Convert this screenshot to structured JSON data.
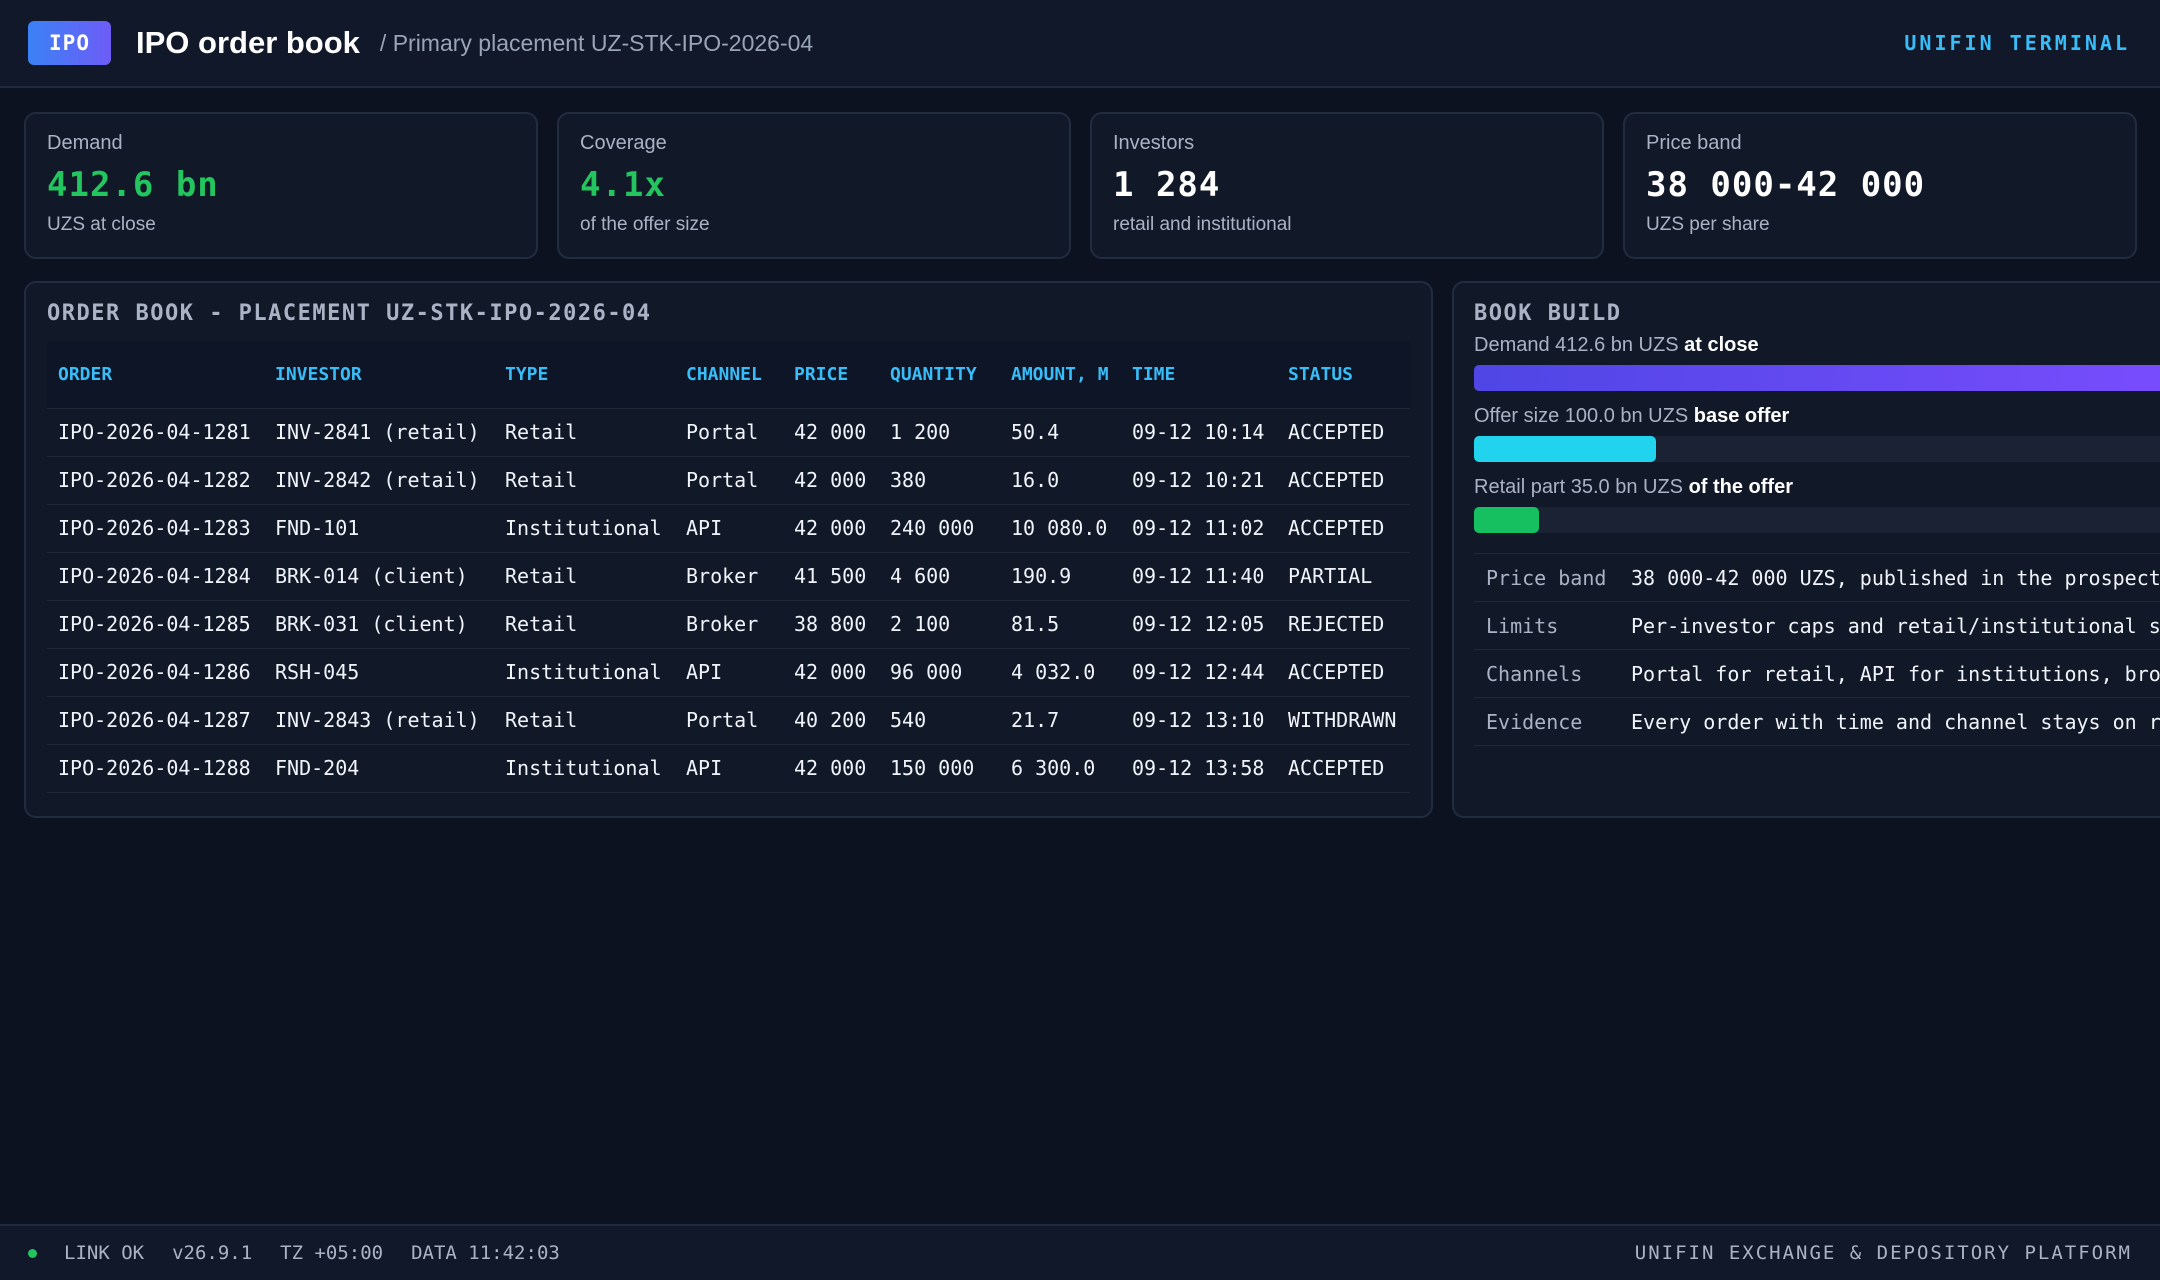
{
  "header": {
    "badge": "IPO",
    "title": "IPO order book",
    "subtitle": "/ Primary placement UZ-STK-IPO-2026-04",
    "brand": "UNIFIN TERMINAL"
  },
  "kpis": [
    {
      "label": "Demand",
      "value": "412.6 bn",
      "note": "UZS at close"
    },
    {
      "label": "Coverage",
      "value": "4.1x",
      "note": "of the offer size"
    },
    {
      "label": "Investors",
      "value": "1 284",
      "note": "retail and institutional"
    },
    {
      "label": "Price band",
      "value": "38 000-42 000",
      "note": "UZS per share"
    }
  ],
  "order_book": {
    "title": "ORDER BOOK - PLACEMENT UZ-STK-IPO-2026-04",
    "columns": [
      "ORDER",
      "INVESTOR",
      "TYPE",
      "CHANNEL",
      "PRICE",
      "QUANTITY",
      "AMOUNT, M",
      "TIME",
      "STATUS"
    ],
    "rows": [
      [
        "IPO-2026-04-1281",
        "INV-2841 (retail)",
        "Retail",
        "Portal",
        "42 000",
        "1 200",
        "50.4",
        "09-12 10:14",
        "ACCEPTED"
      ],
      [
        "IPO-2026-04-1282",
        "INV-2842 (retail)",
        "Retail",
        "Portal",
        "42 000",
        "380",
        "16.0",
        "09-12 10:21",
        "ACCEPTED"
      ],
      [
        "IPO-2026-04-1283",
        "FND-101",
        "Institutional",
        "API",
        "42 000",
        "240 000",
        "10 080.0",
        "09-12 11:02",
        "ACCEPTED"
      ],
      [
        "IPO-2026-04-1284",
        "BRK-014 (client)",
        "Retail",
        "Broker",
        "41 500",
        "4 600",
        "190.9",
        "09-12 11:40",
        "PARTIAL"
      ],
      [
        "IPO-2026-04-1285",
        "BRK-031 (client)",
        "Retail",
        "Broker",
        "38 800",
        "2 100",
        "81.5",
        "09-12 12:05",
        "REJECTED"
      ],
      [
        "IPO-2026-04-1286",
        "RSH-045",
        "Institutional",
        "API",
        "42 000",
        "96 000",
        "4 032.0",
        "09-12 12:44",
        "ACCEPTED"
      ],
      [
        "IPO-2026-04-1287",
        "INV-2843 (retail)",
        "Retail",
        "Portal",
        "40 200",
        "540",
        "21.7",
        "09-12 13:10",
        "WITHDRAWN"
      ],
      [
        "IPO-2026-04-1288",
        "FND-204",
        "Institutional",
        "API",
        "42 000",
        "150 000",
        "6 300.0",
        "09-12 13:58",
        "ACCEPTED"
      ]
    ]
  },
  "book_build": {
    "title": "BOOK BUILD",
    "bars": [
      {
        "label": "Demand 412.6 bn UZS",
        "note": "at close",
        "fraction": 1.0,
        "color": "#7c4dff",
        "color2": "#4f46e5"
      },
      {
        "label": "Offer size 100.0 bn UZS",
        "note": "base offer",
        "fraction": 0.24,
        "color": "#22d3ee",
        "color2": "#22d3ee"
      },
      {
        "label": "Retail part 35.0 bn UZS",
        "note": "of the offer",
        "fraction": 0.085,
        "color": "#16c060",
        "color2": "#16c060"
      }
    ],
    "info": [
      {
        "key": "Price band",
        "value": "38 000-42 000 UZS, published in the prospect"
      },
      {
        "key": "Limits",
        "value": "Per-investor caps and retail/institutional s"
      },
      {
        "key": "Channels",
        "value": "Portal for retail, API for institutions, bro"
      },
      {
        "key": "Evidence",
        "value": "Every order with time and channel stays on r"
      }
    ]
  },
  "footer": {
    "link": "LINK OK",
    "version": "v26.9.1",
    "tz": "TZ +05:00",
    "data": "DATA 11:42:03",
    "platform": "UNIFIN EXCHANGE & DEPOSITORY PLATFORM"
  }
}
